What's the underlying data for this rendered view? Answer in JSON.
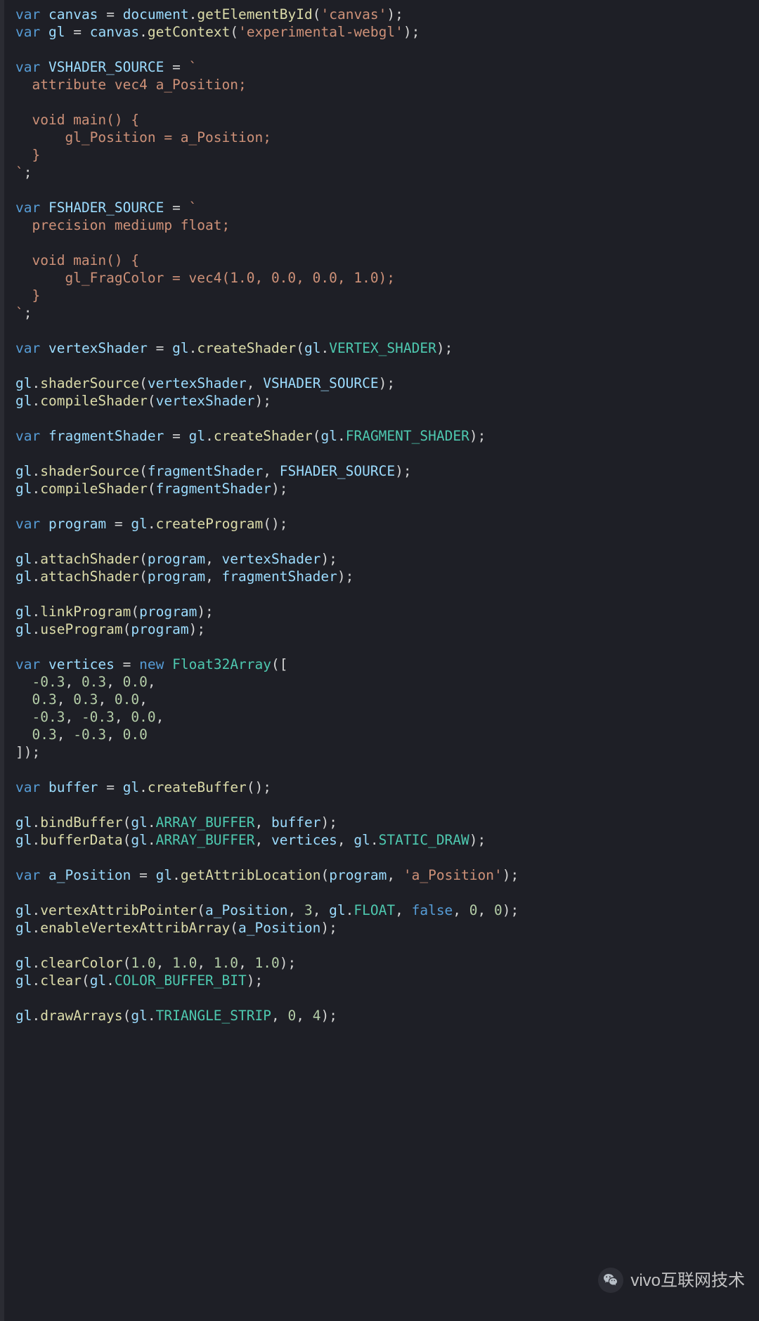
{
  "watermark": {
    "label": "vivo互联网技术"
  },
  "code": {
    "tokens": [
      [
        [
          "kw",
          "var"
        ],
        [
          "pn",
          " "
        ],
        [
          "id",
          "canvas"
        ],
        [
          "pn",
          " "
        ],
        [
          "op",
          "="
        ],
        [
          "pn",
          " "
        ],
        [
          "obj",
          "document"
        ],
        [
          "pn",
          "."
        ],
        [
          "fn",
          "getElementById"
        ],
        [
          "pn",
          "("
        ],
        [
          "str",
          "'canvas'"
        ],
        [
          "pn",
          ");"
        ]
      ],
      [
        [
          "kw",
          "var"
        ],
        [
          "pn",
          " "
        ],
        [
          "id",
          "gl"
        ],
        [
          "pn",
          " "
        ],
        [
          "op",
          "="
        ],
        [
          "pn",
          " "
        ],
        [
          "obj",
          "canvas"
        ],
        [
          "pn",
          "."
        ],
        [
          "fn",
          "getContext"
        ],
        [
          "pn",
          "("
        ],
        [
          "str",
          "'experimental-webgl'"
        ],
        [
          "pn",
          ");"
        ]
      ],
      [],
      [
        [
          "kw",
          "var"
        ],
        [
          "pn",
          " "
        ],
        [
          "id",
          "VSHADER_SOURCE"
        ],
        [
          "pn",
          " "
        ],
        [
          "op",
          "="
        ],
        [
          "pn",
          " "
        ],
        [
          "str",
          "`"
        ]
      ],
      [
        [
          "str",
          "  attribute vec4 a_Position;"
        ]
      ],
      [],
      [
        [
          "str",
          "  void main() {"
        ]
      ],
      [
        [
          "str",
          "      gl_Position = a_Position;"
        ]
      ],
      [
        [
          "str",
          "  }"
        ]
      ],
      [
        [
          "str",
          "`"
        ],
        [
          "pn",
          ";"
        ]
      ],
      [],
      [
        [
          "kw",
          "var"
        ],
        [
          "pn",
          " "
        ],
        [
          "id",
          "FSHADER_SOURCE"
        ],
        [
          "pn",
          " "
        ],
        [
          "op",
          "="
        ],
        [
          "pn",
          " "
        ],
        [
          "str",
          "`"
        ]
      ],
      [
        [
          "str",
          "  precision mediump float;"
        ]
      ],
      [],
      [
        [
          "str",
          "  void main() {"
        ]
      ],
      [
        [
          "str",
          "      gl_FragColor = vec4(1.0, 0.0, 0.0, 1.0);"
        ]
      ],
      [
        [
          "str",
          "  }"
        ]
      ],
      [
        [
          "str",
          "`"
        ],
        [
          "pn",
          ";"
        ]
      ],
      [],
      [
        [
          "kw",
          "var"
        ],
        [
          "pn",
          " "
        ],
        [
          "id",
          "vertexShader"
        ],
        [
          "pn",
          " "
        ],
        [
          "op",
          "="
        ],
        [
          "pn",
          " "
        ],
        [
          "obj",
          "gl"
        ],
        [
          "pn",
          "."
        ],
        [
          "fn",
          "createShader"
        ],
        [
          "pn",
          "("
        ],
        [
          "obj",
          "gl"
        ],
        [
          "pn",
          "."
        ],
        [
          "const",
          "VERTEX_SHADER"
        ],
        [
          "pn",
          ");"
        ]
      ],
      [],
      [
        [
          "obj",
          "gl"
        ],
        [
          "pn",
          "."
        ],
        [
          "fn",
          "shaderSource"
        ],
        [
          "pn",
          "("
        ],
        [
          "id",
          "vertexShader"
        ],
        [
          "pn",
          ", "
        ],
        [
          "id",
          "VSHADER_SOURCE"
        ],
        [
          "pn",
          ");"
        ]
      ],
      [
        [
          "obj",
          "gl"
        ],
        [
          "pn",
          "."
        ],
        [
          "fn",
          "compileShader"
        ],
        [
          "pn",
          "("
        ],
        [
          "id",
          "vertexShader"
        ],
        [
          "pn",
          ");"
        ]
      ],
      [],
      [
        [
          "kw",
          "var"
        ],
        [
          "pn",
          " "
        ],
        [
          "id",
          "fragmentShader"
        ],
        [
          "pn",
          " "
        ],
        [
          "op",
          "="
        ],
        [
          "pn",
          " "
        ],
        [
          "obj",
          "gl"
        ],
        [
          "pn",
          "."
        ],
        [
          "fn",
          "createShader"
        ],
        [
          "pn",
          "("
        ],
        [
          "obj",
          "gl"
        ],
        [
          "pn",
          "."
        ],
        [
          "const",
          "FRAGMENT_SHADER"
        ],
        [
          "pn",
          ");"
        ]
      ],
      [],
      [
        [
          "obj",
          "gl"
        ],
        [
          "pn",
          "."
        ],
        [
          "fn",
          "shaderSource"
        ],
        [
          "pn",
          "("
        ],
        [
          "id",
          "fragmentShader"
        ],
        [
          "pn",
          ", "
        ],
        [
          "id",
          "FSHADER_SOURCE"
        ],
        [
          "pn",
          ");"
        ]
      ],
      [
        [
          "obj",
          "gl"
        ],
        [
          "pn",
          "."
        ],
        [
          "fn",
          "compileShader"
        ],
        [
          "pn",
          "("
        ],
        [
          "id",
          "fragmentShader"
        ],
        [
          "pn",
          ");"
        ]
      ],
      [],
      [
        [
          "kw",
          "var"
        ],
        [
          "pn",
          " "
        ],
        [
          "id",
          "program"
        ],
        [
          "pn",
          " "
        ],
        [
          "op",
          "="
        ],
        [
          "pn",
          " "
        ],
        [
          "obj",
          "gl"
        ],
        [
          "pn",
          "."
        ],
        [
          "fn",
          "createProgram"
        ],
        [
          "pn",
          "();"
        ]
      ],
      [],
      [
        [
          "obj",
          "gl"
        ],
        [
          "pn",
          "."
        ],
        [
          "fn",
          "attachShader"
        ],
        [
          "pn",
          "("
        ],
        [
          "id",
          "program"
        ],
        [
          "pn",
          ", "
        ],
        [
          "id",
          "vertexShader"
        ],
        [
          "pn",
          ");"
        ]
      ],
      [
        [
          "obj",
          "gl"
        ],
        [
          "pn",
          "."
        ],
        [
          "fn",
          "attachShader"
        ],
        [
          "pn",
          "("
        ],
        [
          "id",
          "program"
        ],
        [
          "pn",
          ", "
        ],
        [
          "id",
          "fragmentShader"
        ],
        [
          "pn",
          ");"
        ]
      ],
      [],
      [
        [
          "obj",
          "gl"
        ],
        [
          "pn",
          "."
        ],
        [
          "fn",
          "linkProgram"
        ],
        [
          "pn",
          "("
        ],
        [
          "id",
          "program"
        ],
        [
          "pn",
          ");"
        ]
      ],
      [
        [
          "obj",
          "gl"
        ],
        [
          "pn",
          "."
        ],
        [
          "fn",
          "useProgram"
        ],
        [
          "pn",
          "("
        ],
        [
          "id",
          "program"
        ],
        [
          "pn",
          ");"
        ]
      ],
      [],
      [
        [
          "kw",
          "var"
        ],
        [
          "pn",
          " "
        ],
        [
          "id",
          "vertices"
        ],
        [
          "pn",
          " "
        ],
        [
          "op",
          "="
        ],
        [
          "pn",
          " "
        ],
        [
          "kw",
          "new"
        ],
        [
          "pn",
          " "
        ],
        [
          "class",
          "Float32Array"
        ],
        [
          "pn",
          "(["
        ]
      ],
      [
        [
          "pn",
          "  "
        ],
        [
          "num",
          "-0.3"
        ],
        [
          "pn",
          ", "
        ],
        [
          "num",
          "0.3"
        ],
        [
          "pn",
          ", "
        ],
        [
          "num",
          "0.0"
        ],
        [
          "pn",
          ","
        ]
      ],
      [
        [
          "pn",
          "  "
        ],
        [
          "num",
          "0.3"
        ],
        [
          "pn",
          ", "
        ],
        [
          "num",
          "0.3"
        ],
        [
          "pn",
          ", "
        ],
        [
          "num",
          "0.0"
        ],
        [
          "pn",
          ","
        ]
      ],
      [
        [
          "pn",
          "  "
        ],
        [
          "num",
          "-0.3"
        ],
        [
          "pn",
          ", "
        ],
        [
          "num",
          "-0.3"
        ],
        [
          "pn",
          ", "
        ],
        [
          "num",
          "0.0"
        ],
        [
          "pn",
          ","
        ]
      ],
      [
        [
          "pn",
          "  "
        ],
        [
          "num",
          "0.3"
        ],
        [
          "pn",
          ", "
        ],
        [
          "num",
          "-0.3"
        ],
        [
          "pn",
          ", "
        ],
        [
          "num",
          "0.0"
        ]
      ],
      [
        [
          "pn",
          "]);"
        ]
      ],
      [],
      [
        [
          "kw",
          "var"
        ],
        [
          "pn",
          " "
        ],
        [
          "id",
          "buffer"
        ],
        [
          "pn",
          " "
        ],
        [
          "op",
          "="
        ],
        [
          "pn",
          " "
        ],
        [
          "obj",
          "gl"
        ],
        [
          "pn",
          "."
        ],
        [
          "fn",
          "createBuffer"
        ],
        [
          "pn",
          "();"
        ]
      ],
      [],
      [
        [
          "obj",
          "gl"
        ],
        [
          "pn",
          "."
        ],
        [
          "fn",
          "bindBuffer"
        ],
        [
          "pn",
          "("
        ],
        [
          "obj",
          "gl"
        ],
        [
          "pn",
          "."
        ],
        [
          "const",
          "ARRAY_BUFFER"
        ],
        [
          "pn",
          ", "
        ],
        [
          "id",
          "buffer"
        ],
        [
          "pn",
          ");"
        ]
      ],
      [
        [
          "obj",
          "gl"
        ],
        [
          "pn",
          "."
        ],
        [
          "fn",
          "bufferData"
        ],
        [
          "pn",
          "("
        ],
        [
          "obj",
          "gl"
        ],
        [
          "pn",
          "."
        ],
        [
          "const",
          "ARRAY_BUFFER"
        ],
        [
          "pn",
          ", "
        ],
        [
          "id",
          "vertices"
        ],
        [
          "pn",
          ", "
        ],
        [
          "obj",
          "gl"
        ],
        [
          "pn",
          "."
        ],
        [
          "const",
          "STATIC_DRAW"
        ],
        [
          "pn",
          ");"
        ]
      ],
      [],
      [
        [
          "kw",
          "var"
        ],
        [
          "pn",
          " "
        ],
        [
          "id",
          "a_Position"
        ],
        [
          "pn",
          " "
        ],
        [
          "op",
          "="
        ],
        [
          "pn",
          " "
        ],
        [
          "obj",
          "gl"
        ],
        [
          "pn",
          "."
        ],
        [
          "fn",
          "getAttribLocation"
        ],
        [
          "pn",
          "("
        ],
        [
          "id",
          "program"
        ],
        [
          "pn",
          ", "
        ],
        [
          "str",
          "'a_Position'"
        ],
        [
          "pn",
          ");"
        ]
      ],
      [],
      [
        [
          "obj",
          "gl"
        ],
        [
          "pn",
          "."
        ],
        [
          "fn",
          "vertexAttribPointer"
        ],
        [
          "pn",
          "("
        ],
        [
          "id",
          "a_Position"
        ],
        [
          "pn",
          ", "
        ],
        [
          "num",
          "3"
        ],
        [
          "pn",
          ", "
        ],
        [
          "obj",
          "gl"
        ],
        [
          "pn",
          "."
        ],
        [
          "const",
          "FLOAT"
        ],
        [
          "pn",
          ", "
        ],
        [
          "bool",
          "false"
        ],
        [
          "pn",
          ", "
        ],
        [
          "num",
          "0"
        ],
        [
          "pn",
          ", "
        ],
        [
          "num",
          "0"
        ],
        [
          "pn",
          ");"
        ]
      ],
      [
        [
          "obj",
          "gl"
        ],
        [
          "pn",
          "."
        ],
        [
          "fn",
          "enableVertexAttribArray"
        ],
        [
          "pn",
          "("
        ],
        [
          "id",
          "a_Position"
        ],
        [
          "pn",
          ");"
        ]
      ],
      [],
      [
        [
          "obj",
          "gl"
        ],
        [
          "pn",
          "."
        ],
        [
          "fn",
          "clearColor"
        ],
        [
          "pn",
          "("
        ],
        [
          "num",
          "1.0"
        ],
        [
          "pn",
          ", "
        ],
        [
          "num",
          "1.0"
        ],
        [
          "pn",
          ", "
        ],
        [
          "num",
          "1.0"
        ],
        [
          "pn",
          ", "
        ],
        [
          "num",
          "1.0"
        ],
        [
          "pn",
          ");"
        ]
      ],
      [
        [
          "obj",
          "gl"
        ],
        [
          "pn",
          "."
        ],
        [
          "fn",
          "clear"
        ],
        [
          "pn",
          "("
        ],
        [
          "obj",
          "gl"
        ],
        [
          "pn",
          "."
        ],
        [
          "const",
          "COLOR_BUFFER_BIT"
        ],
        [
          "pn",
          ");"
        ]
      ],
      [],
      [
        [
          "obj",
          "gl"
        ],
        [
          "pn",
          "."
        ],
        [
          "fn",
          "drawArrays"
        ],
        [
          "pn",
          "("
        ],
        [
          "obj",
          "gl"
        ],
        [
          "pn",
          "."
        ],
        [
          "const",
          "TRIANGLE_STRIP"
        ],
        [
          "pn",
          ", "
        ],
        [
          "num",
          "0"
        ],
        [
          "pn",
          ", "
        ],
        [
          "num",
          "4"
        ],
        [
          "pn",
          ");"
        ]
      ]
    ]
  }
}
